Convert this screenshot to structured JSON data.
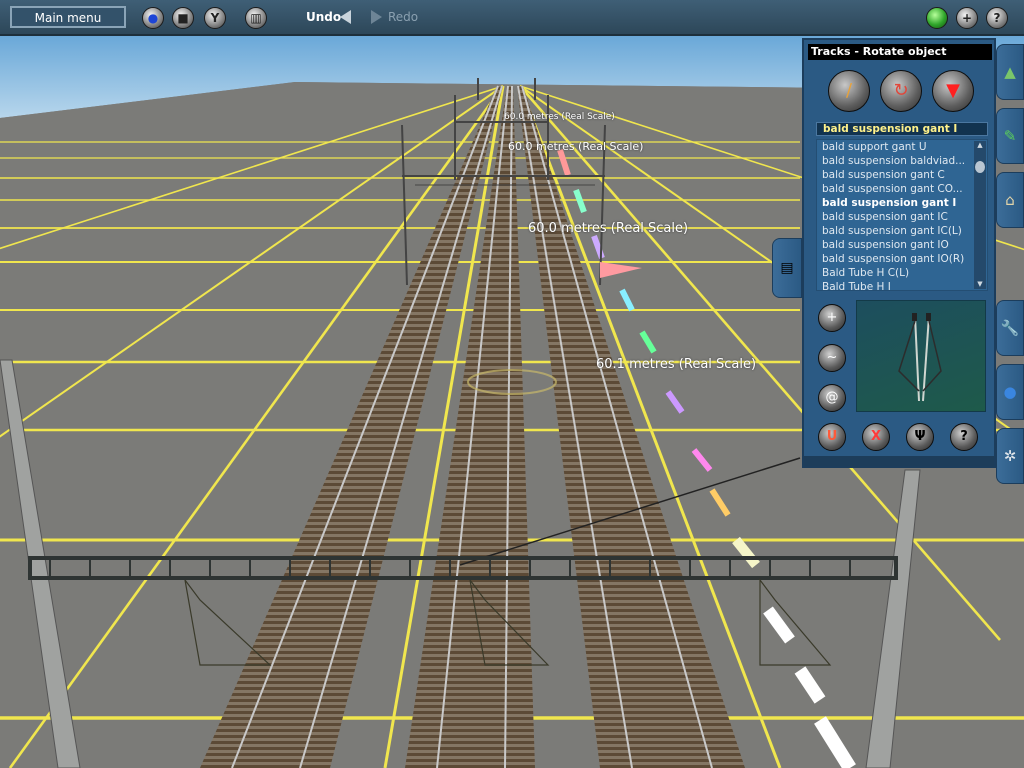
{
  "toolbar": {
    "main_menu": "Main menu",
    "undo": "Undo",
    "redo": "Redo",
    "icons": [
      "globe-icon",
      "stop-icon",
      "filter-icon",
      "trash-icon",
      "green-light-icon",
      "plus-icon",
      "help-icon"
    ]
  },
  "measurements": [
    "60.0 metres  (Real Scale)",
    "60.0 metres  (Real Scale)",
    "60.0 metres  (Real Scale)",
    "60.1 metres  (Real Scale)"
  ],
  "panel": {
    "title": "Tracks - Rotate object",
    "selected": "bald suspension gant I",
    "items": [
      "bald support gant U",
      "bald suspension baldviad...",
      "bald suspension gant C",
      "bald suspension gant CO...",
      "bald suspension gant I",
      "bald suspension gant IC",
      "bald suspension gant IC(L)",
      "bald suspension gant IO",
      "bald suspension gant IO(R)",
      "Bald Tube H C(L)",
      "Bald Tube H I"
    ],
    "side_buttons": [
      "+",
      "~",
      "@"
    ],
    "bottom_buttons": [
      "U",
      "X",
      "Ψ",
      "?"
    ]
  },
  "colors": {
    "toolbar": "#34536a",
    "panel": "#2b5a84",
    "grid": "#f2ea56",
    "sky": "#8fc1e3",
    "ground": "#7a7a7a"
  }
}
